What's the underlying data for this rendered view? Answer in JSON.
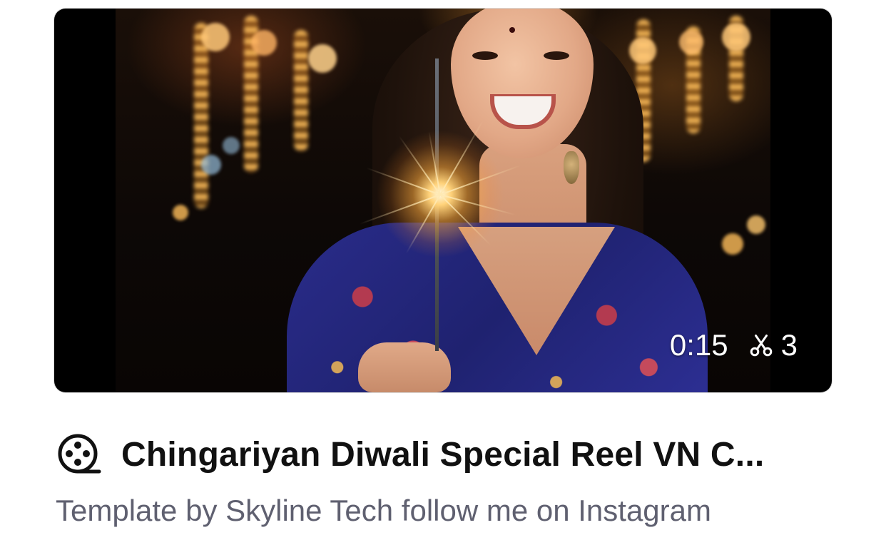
{
  "template_card": {
    "thumbnail": {
      "duration": "0:15",
      "clip_count": "3",
      "clip_icon": "scissors-icon"
    },
    "title_icon": "film-reel-icon",
    "title": "Chingariyan Diwali Special Reel VN C...",
    "subtitle": "Template by Skyline Tech follow me on Instagram"
  },
  "colors": {
    "title_text": "#111111",
    "subtitle_text": "#5f6070",
    "overlay_text": "#ffffff"
  }
}
